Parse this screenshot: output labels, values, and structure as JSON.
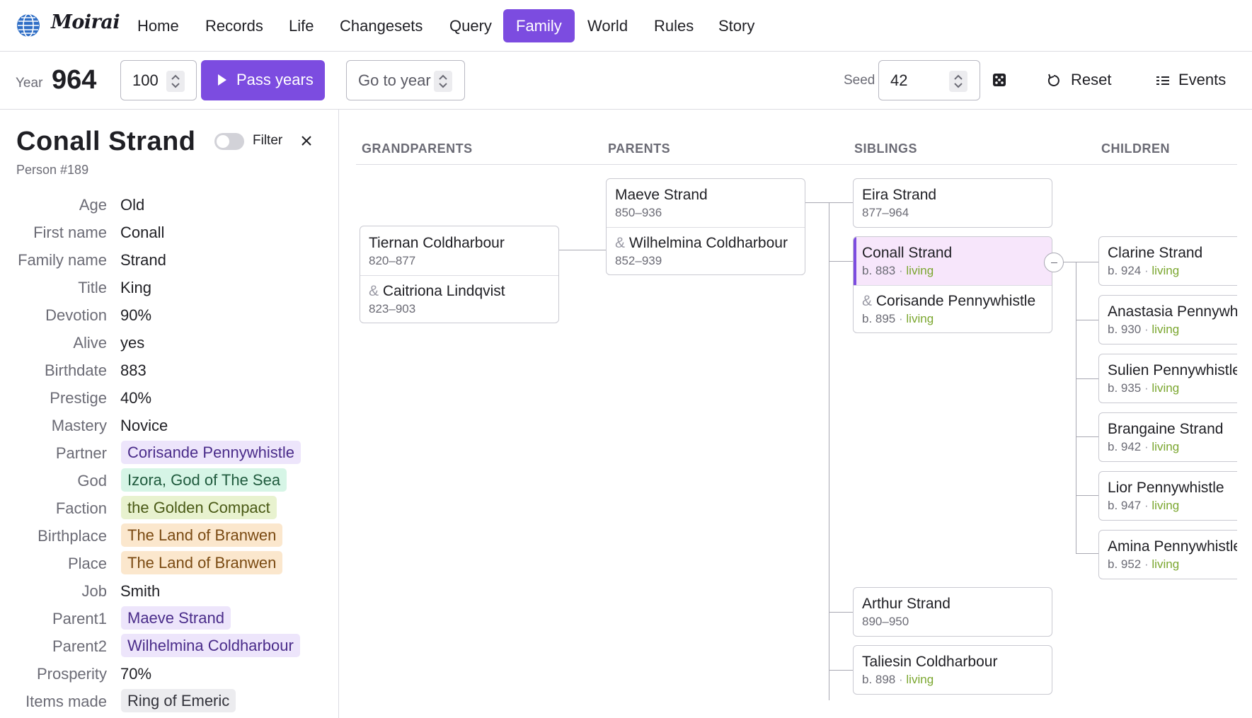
{
  "brand": {
    "name": "Moirai"
  },
  "nav": [
    "Home",
    "Records",
    "Life",
    "Changesets",
    "Query",
    "Family",
    "World",
    "Rules",
    "Story"
  ],
  "toolbar": {
    "year_label": "Year",
    "year": "964",
    "pass_amount": "100",
    "pass_button": "Pass years",
    "goto_placeholder": "Go to year",
    "seed_label": "Seed",
    "seed": "42",
    "reset": "Reset",
    "events": "Events"
  },
  "person": {
    "name": "Conall Strand",
    "id": "Person #189",
    "filter_label": "Filter",
    "attrs": [
      {
        "label": "Age",
        "value": "Old"
      },
      {
        "label": "First name",
        "value": "Conall"
      },
      {
        "label": "Family name",
        "value": "Strand"
      },
      {
        "label": "Title",
        "value": "King"
      },
      {
        "label": "Devotion",
        "value": "90%"
      },
      {
        "label": "Alive",
        "value": "yes"
      },
      {
        "label": "Birthdate",
        "value": "883"
      },
      {
        "label": "Prestige",
        "value": "40%"
      },
      {
        "label": "Mastery",
        "value": "Novice"
      },
      {
        "label": "Partner",
        "value": "Corisande Pennywhistle"
      },
      {
        "label": "God",
        "value": "Izora, God of The Sea"
      },
      {
        "label": "Faction",
        "value": "the Golden Compact"
      },
      {
        "label": "Birthplace",
        "value": "The Land of Branwen"
      },
      {
        "label": "Place",
        "value": "The Land of Branwen"
      },
      {
        "label": "Job",
        "value": "Smith"
      },
      {
        "label": "Parent1",
        "value": "Maeve Strand"
      },
      {
        "label": "Parent2",
        "value": "Wilhelmina Coldharbour"
      },
      {
        "label": "Prosperity",
        "value": "70%"
      },
      {
        "label": "Items made",
        "value": "Ring of Emeric"
      }
    ]
  },
  "tree": {
    "headers": [
      "GRANDPARENTS",
      "PARENTS",
      "SIBLINGS",
      "CHILDREN"
    ],
    "grandparents": {
      "a": {
        "name": "Tiernan Coldharbour",
        "dates": "820–877"
      },
      "b": {
        "amp": "&",
        "name": "Caitriona Lindqvist",
        "dates": "823–903"
      }
    },
    "parents": {
      "a": {
        "name": "Maeve Strand",
        "dates": "850–936"
      },
      "b": {
        "amp": "&",
        "name": "Wilhelmina Coldharbour",
        "dates": "852–939"
      }
    },
    "siblings": {
      "eira": {
        "name": "Eira Strand",
        "dates": "877–964"
      },
      "self": {
        "name": "Conall Strand",
        "born": "b. 883",
        "sep": "·",
        "status": "living"
      },
      "partner": {
        "amp": "&",
        "name": "Corisande Pennywhistle",
        "born": "b. 895",
        "sep": "·",
        "status": "living"
      },
      "arthur": {
        "name": "Arthur Strand",
        "dates": "890–950"
      },
      "taliesin": {
        "name": "Taliesin Coldharbour",
        "born": "b. 898",
        "sep": "·",
        "status": "living"
      }
    },
    "children": [
      {
        "name": "Clarine Strand",
        "born": "b. 924",
        "sep": "·",
        "status": "living"
      },
      {
        "name": "Anastasia Pennywh",
        "born": "b. 930",
        "sep": "·",
        "status": "living"
      },
      {
        "name": "Sulien Pennywhistle",
        "born": "b. 935",
        "sep": "·",
        "status": "living"
      },
      {
        "name": "Brangaine Strand",
        "born": "b. 942",
        "sep": "·",
        "status": "living"
      },
      {
        "name": "Lior Pennywhistle",
        "born": "b. 947",
        "sep": "·",
        "status": "living"
      },
      {
        "name": "Amina Pennywhistle",
        "born": "b. 952",
        "sep": "·",
        "status": "living"
      }
    ]
  },
  "colors": {
    "accent": "#7c4ce0",
    "living": "#7aa62e",
    "chip_person": "#ede5fb",
    "chip_god": "#d6f5e6",
    "chip_faction": "#e8f2cf",
    "chip_place": "#fbe7cd",
    "chip_item": "#ececef"
  }
}
